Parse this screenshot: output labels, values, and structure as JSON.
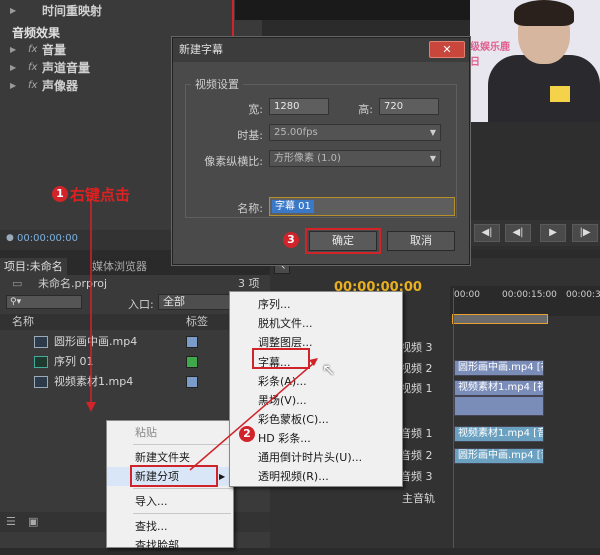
{
  "effects_panel": {
    "top_item": "时间重映射",
    "audio_effects_header": "音频效果",
    "items": [
      "音量",
      "声道音量",
      "声像器"
    ],
    "fx_tag": "fx",
    "timecode": "00:00:00:00"
  },
  "preview": {
    "banner_text": "级娱乐鹿日"
  },
  "dialog": {
    "title": "新建字幕",
    "close": "✕",
    "group_title": "视频设置",
    "width_label": "宽:",
    "width_value": "1280",
    "height_label": "高:",
    "height_value": "720",
    "timebase_label": "时基:",
    "timebase_value": "25.00fps",
    "pixel_ratio_label": "像素纵横比:",
    "pixel_ratio_value": "方形像素 (1.0)",
    "name_label": "名称:",
    "name_value": "字幕 01",
    "ok_label": "确定",
    "cancel_label": "取消"
  },
  "project_panel": {
    "tab_project": "项目:未命名",
    "tab_media": "媒体浏览器",
    "file_name": "未命名.prproj",
    "item_count": "3 项",
    "entry_label": "入口:",
    "entry_value": "全部",
    "col_name": "名称",
    "col_label": "标签",
    "items": [
      {
        "name": "圆形画中画.mp4",
        "color": "#7a9cc8"
      },
      {
        "name": "序列 01",
        "color": "#3fa84a"
      },
      {
        "name": "视频素材1.mp4",
        "color": "#7a9cc8"
      }
    ]
  },
  "timeline": {
    "timecode": "00:00:00:00",
    "ticks": [
      "00:00",
      "00:00:15:00",
      "00:00:30:"
    ],
    "tracks": [
      "视频 3",
      "视频 2",
      "视频 1",
      "音频 1",
      "音频 2",
      "音频 3",
      "主音轨"
    ],
    "clips": [
      "圆形画中画.mp4 [视",
      "视频素材1.mp4 [视",
      "视频素材1.mp4 [音",
      "圆形画中画.mp4 [音"
    ]
  },
  "context_menu": {
    "paste": "粘贴",
    "new_folder": "新建文件夹",
    "new_item": "新建分项",
    "import": "导入...",
    "find": "查找...",
    "find_face": "查找脸部"
  },
  "submenu": {
    "items": [
      "序列...",
      "脱机文件...",
      "调整图层...",
      "字幕...",
      "彩条(A)...",
      "黑场(V)...",
      "彩色蒙板(C)...",
      "HD 彩条...",
      "通用倒计时片头(U)...",
      "透明视频(R)..."
    ]
  },
  "annotations": {
    "step1_num": "1",
    "step1_text": "右键点击",
    "step2_num": "2",
    "step3_num": "3",
    "accent": "#d0232a"
  }
}
